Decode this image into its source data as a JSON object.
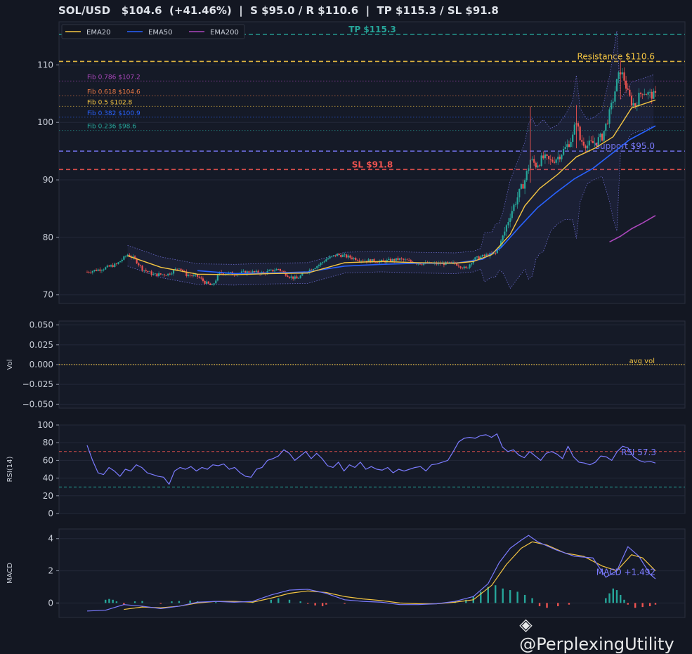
{
  "title": "SOL/USD   $104.6  (+41.46%)  |  S $95.0 / R $110.6  |  TP $115.3 / SL $91.8",
  "watermark": "@PerplexingUtility",
  "colors": {
    "bg": "#131722",
    "panel": "#151a27",
    "grid": "#232838",
    "up": "#26a69a",
    "down": "#ef5350",
    "ema20": "#f4c542",
    "ema50": "#2962ff",
    "ema200": "#ab47bc",
    "rsi": "#7b7bff",
    "macd": "#7b7bff",
    "signal": "#f4c542"
  },
  "chart_data": [
    {
      "type": "candlestick",
      "name": "price",
      "ylim": [
        68.5,
        117.5
      ],
      "yticks": [
        70,
        80,
        90,
        100,
        110
      ],
      "legend": {
        "placement": "top-left",
        "entries": [
          "EMA20",
          "EMA50",
          "EMA200"
        ]
      },
      "levels": [
        {
          "label": "TP $115.3",
          "value": 115.3,
          "color": "#26a69a",
          "style": "dashed"
        },
        {
          "label": "Resistance $110.6",
          "value": 110.6,
          "color": "#f4c542",
          "style": "dashed"
        },
        {
          "label": "Fib 0.786 $107.2",
          "value": 107.2,
          "color": "#ab47bc",
          "style": "dotted"
        },
        {
          "label": "Fib 0.618 $104.6",
          "value": 104.6,
          "color": "#ef7b45",
          "style": "dotted"
        },
        {
          "label": "Fib 0.5 $102.8",
          "value": 102.8,
          "color": "#f4c542",
          "style": "dotted"
        },
        {
          "label": "Fib 0.382 $100.9",
          "value": 100.9,
          "color": "#2962ff",
          "style": "dotted"
        },
        {
          "label": "Fib 0.236 $98.6",
          "value": 98.6,
          "color": "#26a69a",
          "style": "dotted"
        },
        {
          "label": "Support $95.0",
          "value": 95.0,
          "color": "#7b7bff",
          "style": "dashed"
        },
        {
          "label": "SL $91.8",
          "value": 91.8,
          "color": "#ef5350",
          "style": "dashed"
        }
      ],
      "close_path": [
        [
          0,
          74
        ],
        [
          8,
          74.5
        ],
        [
          16,
          75.3
        ],
        [
          22,
          77
        ],
        [
          26,
          76.2
        ],
        [
          30,
          74.5
        ],
        [
          36,
          73.5
        ],
        [
          44,
          73.6
        ],
        [
          50,
          74.8
        ],
        [
          54,
          73.5
        ],
        [
          60,
          73.2
        ],
        [
          64,
          72.2
        ],
        [
          68,
          71.5
        ],
        [
          72,
          73.8
        ],
        [
          80,
          73.7
        ],
        [
          88,
          74
        ],
        [
          96,
          73.8
        ],
        [
          104,
          74.5
        ],
        [
          110,
          73.2
        ],
        [
          114,
          72.8
        ],
        [
          120,
          74.2
        ],
        [
          126,
          75.2
        ],
        [
          130,
          76.2
        ],
        [
          136,
          77
        ],
        [
          142,
          76.6
        ],
        [
          150,
          76
        ],
        [
          160,
          75.8
        ],
        [
          170,
          76.2
        ],
        [
          180,
          75.5
        ],
        [
          190,
          75.4
        ],
        [
          200,
          75.5
        ],
        [
          206,
          74.5
        ],
        [
          210,
          76.2
        ],
        [
          216,
          76.8
        ],
        [
          222,
          77.2
        ],
        [
          226,
          80
        ],
        [
          230,
          84
        ],
        [
          234,
          87
        ],
        [
          238,
          90
        ],
        [
          241,
          93.5
        ],
        [
          244,
          92.6
        ],
        [
          248,
          93.8
        ],
        [
          252,
          93.2
        ],
        [
          256,
          94
        ],
        [
          260,
          95.5
        ],
        [
          264,
          97.5
        ],
        [
          266,
          100.5
        ],
        [
          268,
          97
        ],
        [
          272,
          96
        ],
        [
          276,
          96.5
        ],
        [
          280,
          97.5
        ],
        [
          284,
          101.5
        ],
        [
          286,
          104
        ],
        [
          288,
          107
        ],
        [
          290,
          109
        ],
        [
          292,
          107.5
        ],
        [
          294,
          105
        ],
        [
          296,
          103.5
        ],
        [
          298,
          103
        ],
        [
          300,
          104.5
        ],
        [
          302,
          105.5
        ],
        [
          306,
          104.8
        ],
        [
          309,
          104.6
        ]
      ],
      "ema20_path": [
        [
          22,
          76.8
        ],
        [
          40,
          74.8
        ],
        [
          60,
          73.6
        ],
        [
          80,
          73.5
        ],
        [
          100,
          73.7
        ],
        [
          120,
          73.8
        ],
        [
          140,
          75.6
        ],
        [
          160,
          75.8
        ],
        [
          180,
          75.6
        ],
        [
          200,
          75.5
        ],
        [
          210,
          75.8
        ],
        [
          220,
          77
        ],
        [
          230,
          80.5
        ],
        [
          238,
          85.5
        ],
        [
          246,
          88.5
        ],
        [
          256,
          91
        ],
        [
          266,
          94
        ],
        [
          276,
          95.5
        ],
        [
          286,
          97.5
        ],
        [
          296,
          102.5
        ],
        [
          309,
          103.9
        ]
      ],
      "ema50_path": [
        [
          60,
          74.2
        ],
        [
          80,
          73.7
        ],
        [
          100,
          73.8
        ],
        [
          120,
          74
        ],
        [
          140,
          75
        ],
        [
          160,
          75.3
        ],
        [
          180,
          75.5
        ],
        [
          200,
          75.5
        ],
        [
          215,
          76.2
        ],
        [
          225,
          78.2
        ],
        [
          235,
          81.8
        ],
        [
          245,
          85.2
        ],
        [
          255,
          87.8
        ],
        [
          265,
          90.2
        ],
        [
          275,
          92
        ],
        [
          285,
          94.5
        ],
        [
          295,
          97
        ],
        [
          309,
          99.4
        ]
      ],
      "ema200_path": [
        [
          284,
          79.2
        ],
        [
          290,
          80.2
        ],
        [
          296,
          81.5
        ],
        [
          302,
          82.5
        ],
        [
          309,
          83.8
        ]
      ]
    },
    {
      "type": "line",
      "name": "volume",
      "ylabel": "Vol",
      "ylim": [
        -0.055,
        0.055
      ],
      "yticks": [
        0.05,
        0.025,
        0.0,
        -0.025,
        -0.05
      ],
      "ytick_labels": [
        "0.050",
        "0.025",
        "0.000",
        "−0.025",
        "−0.050"
      ],
      "reference": {
        "label": "avg vol",
        "value": 0.0
      }
    },
    {
      "type": "line",
      "name": "rsi",
      "ylabel": "RSI(14)",
      "ylim": [
        0,
        100
      ],
      "yticks": [
        0,
        20,
        40,
        60,
        80,
        100
      ],
      "overbought": 70,
      "oversold": 30,
      "label": "RSI 57.3",
      "values": [
        77,
        60,
        46,
        44,
        52,
        48,
        42,
        50,
        48,
        55,
        52,
        46,
        44,
        42,
        41,
        33,
        48,
        52,
        50,
        53,
        48,
        52,
        50,
        55,
        54,
        56,
        50,
        52,
        46,
        42,
        41,
        50,
        52,
        60,
        62,
        65,
        72,
        68,
        60,
        65,
        70,
        62,
        68,
        62,
        54,
        52,
        58,
        48,
        55,
        52,
        58,
        50,
        53,
        50,
        49,
        52,
        46,
        50,
        48,
        50,
        52,
        53,
        48,
        55,
        56,
        58,
        60,
        70,
        81,
        85,
        86,
        85,
        88,
        89,
        86,
        90,
        75,
        70,
        72,
        66,
        63,
        70,
        65,
        60,
        68,
        70,
        67,
        62,
        76,
        64,
        58,
        57,
        55,
        58,
        65,
        64,
        60,
        70,
        76,
        74,
        64,
        60,
        58,
        59,
        57
      ]
    },
    {
      "type": "line",
      "name": "macd",
      "ylabel": "MACD",
      "ylim": [
        -0.9,
        4.6
      ],
      "yticks": [
        0,
        2,
        4
      ],
      "label": "MACD +1.492",
      "macd": [
        [
          0,
          -0.5
        ],
        [
          10,
          -0.45
        ],
        [
          20,
          -0.1
        ],
        [
          30,
          -0.2
        ],
        [
          40,
          -0.35
        ],
        [
          50,
          -0.2
        ],
        [
          60,
          0.05
        ],
        [
          70,
          0.1
        ],
        [
          80,
          0.05
        ],
        [
          90,
          0.1
        ],
        [
          100,
          0.5
        ],
        [
          110,
          0.8
        ],
        [
          120,
          0.85
        ],
        [
          130,
          0.6
        ],
        [
          140,
          0.2
        ],
        [
          150,
          0.1
        ],
        [
          160,
          0.05
        ],
        [
          170,
          -0.1
        ],
        [
          180,
          -0.1
        ],
        [
          190,
          -0.05
        ],
        [
          200,
          0.1
        ],
        [
          210,
          0.4
        ],
        [
          218,
          1.2
        ],
        [
          224,
          2.5
        ],
        [
          230,
          3.4
        ],
        [
          236,
          3.9
        ],
        [
          240,
          4.2
        ],
        [
          245,
          3.8
        ],
        [
          255,
          3.3
        ],
        [
          265,
          2.9
        ],
        [
          275,
          2.8
        ],
        [
          282,
          1.6
        ],
        [
          288,
          2.0
        ],
        [
          294,
          3.5
        ],
        [
          300,
          2.9
        ],
        [
          306,
          1.8
        ],
        [
          309,
          1.5
        ]
      ],
      "signal": [
        [
          20,
          -0.4
        ],
        [
          30,
          -0.25
        ],
        [
          40,
          -0.3
        ],
        [
          50,
          -0.2
        ],
        [
          60,
          0
        ],
        [
          70,
          0.1
        ],
        [
          80,
          0.1
        ],
        [
          90,
          0.05
        ],
        [
          100,
          0.3
        ],
        [
          110,
          0.6
        ],
        [
          120,
          0.75
        ],
        [
          130,
          0.65
        ],
        [
          140,
          0.4
        ],
        [
          150,
          0.25
        ],
        [
          160,
          0.15
        ],
        [
          170,
          0.0
        ],
        [
          180,
          -0.05
        ],
        [
          190,
          -0.05
        ],
        [
          200,
          0.05
        ],
        [
          210,
          0.2
        ],
        [
          220,
          1.1
        ],
        [
          228,
          2.4
        ],
        [
          236,
          3.4
        ],
        [
          242,
          3.8
        ],
        [
          250,
          3.6
        ],
        [
          260,
          3.1
        ],
        [
          270,
          2.9
        ],
        [
          280,
          2.3
        ],
        [
          288,
          2.0
        ],
        [
          296,
          3.0
        ],
        [
          302,
          2.8
        ],
        [
          309,
          2.0
        ]
      ],
      "hist": [
        [
          10,
          0.2
        ],
        [
          12,
          0.25
        ],
        [
          14,
          0.2
        ],
        [
          16,
          0.1
        ],
        [
          20,
          -0.1
        ],
        [
          26,
          0.1
        ],
        [
          30,
          0.12
        ],
        [
          40,
          -0.05
        ],
        [
          46,
          0.1
        ],
        [
          50,
          0.12
        ],
        [
          56,
          0.15
        ],
        [
          60,
          0.1
        ],
        [
          70,
          0.05
        ],
        [
          90,
          0.05
        ],
        [
          100,
          0.2
        ],
        [
          104,
          0.3
        ],
        [
          110,
          0.2
        ],
        [
          116,
          0.1
        ],
        [
          120,
          -0.05
        ],
        [
          124,
          -0.15
        ],
        [
          128,
          -0.2
        ],
        [
          130,
          -0.1
        ],
        [
          140,
          -0.05
        ],
        [
          200,
          0.1
        ],
        [
          206,
          0.2
        ],
        [
          210,
          0.4
        ],
        [
          214,
          0.7
        ],
        [
          218,
          1.0
        ],
        [
          222,
          1.1
        ],
        [
          226,
          0.9
        ],
        [
          230,
          0.8
        ],
        [
          234,
          0.7
        ],
        [
          238,
          0.5
        ],
        [
          242,
          0.3
        ],
        [
          246,
          -0.2
        ],
        [
          250,
          -0.3
        ],
        [
          256,
          -0.2
        ],
        [
          262,
          -0.1
        ],
        [
          282,
          0.3
        ],
        [
          284,
          0.6
        ],
        [
          286,
          0.9
        ],
        [
          288,
          0.8
        ],
        [
          290,
          0.5
        ],
        [
          292,
          0.2
        ],
        [
          294,
          -0.1
        ],
        [
          298,
          -0.3
        ],
        [
          302,
          -0.25
        ],
        [
          306,
          -0.2
        ],
        [
          309,
          -0.1
        ]
      ]
    }
  ]
}
